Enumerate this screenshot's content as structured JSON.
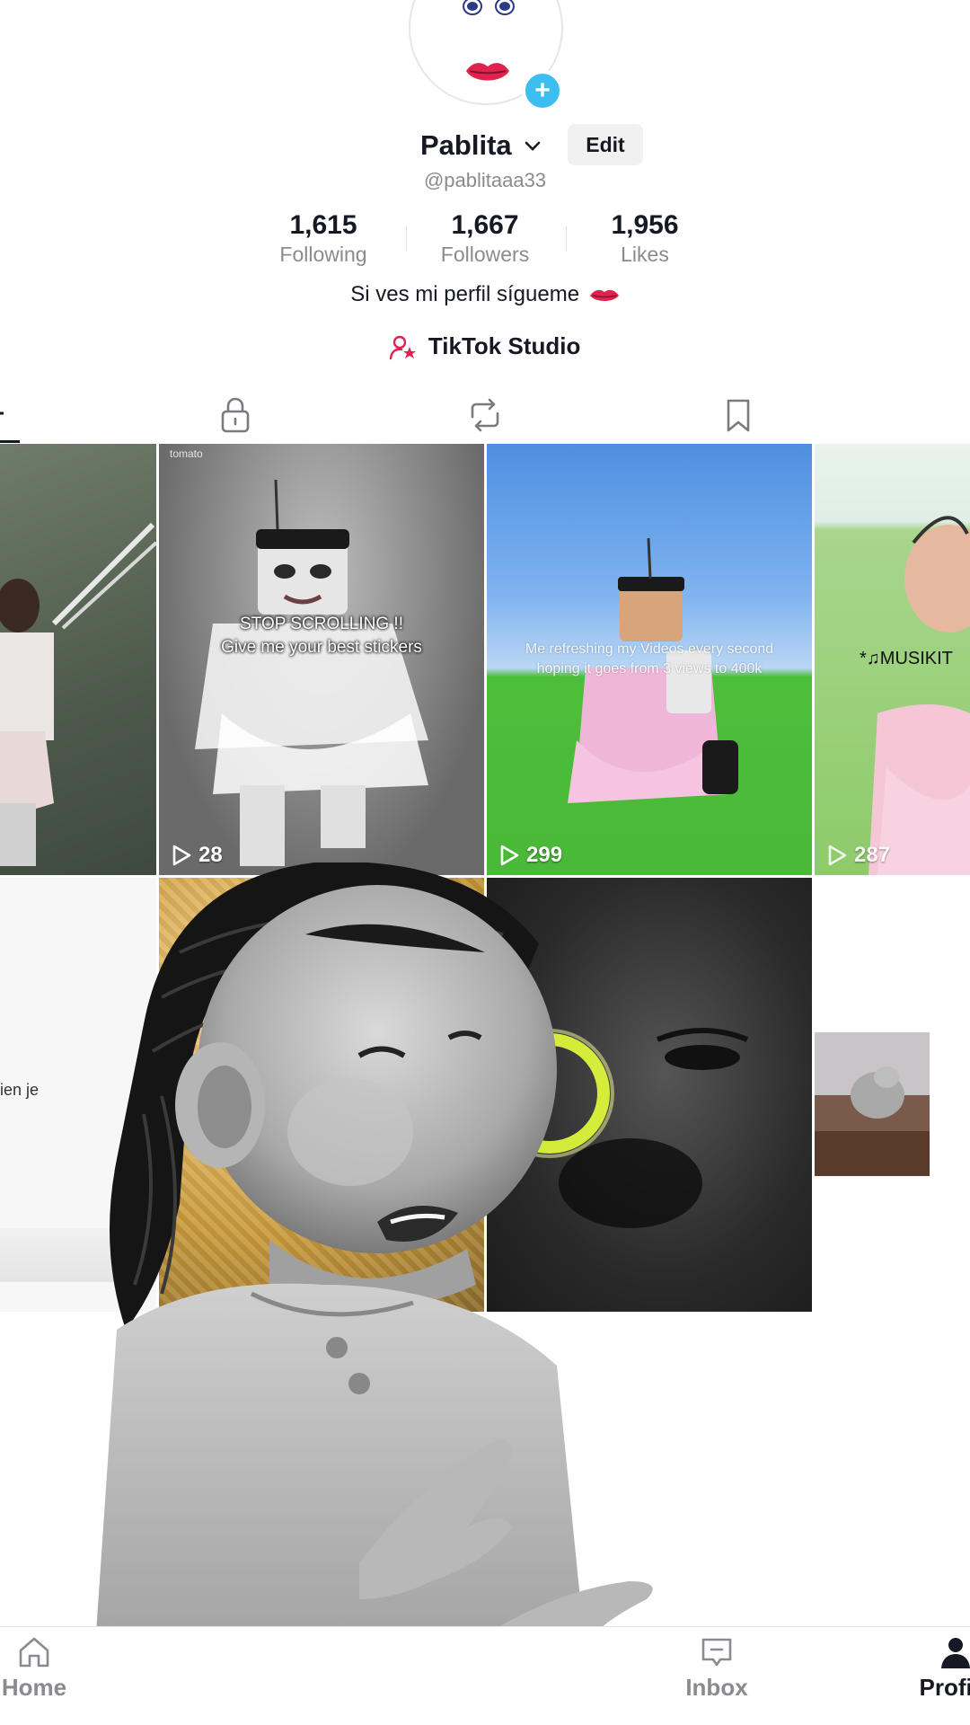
{
  "profile": {
    "name": "Pablita",
    "handle": "@pablitaaa33",
    "edit_label": "Edit",
    "bio": "Si ves mi perfil sígueme",
    "studio_label": "TikTok Studio"
  },
  "stats": [
    {
      "value": "1,615",
      "label": "Following"
    },
    {
      "value": "1,667",
      "label": "Followers"
    },
    {
      "value": "1,956",
      "label": "Likes"
    }
  ],
  "tabs": [
    {
      "icon": "grid-icon"
    },
    {
      "icon": "lock-icon"
    },
    {
      "icon": "repost-icon"
    },
    {
      "icon": "bookmark-icon"
    }
  ],
  "videos": [
    {
      "views": ""
    },
    {
      "watermark": "tomato",
      "caption_line1": "STOP SCROLLING !!",
      "caption_line2": "Give me your best stickers",
      "views": "28"
    },
    {
      "caption_line1": "Me refreshing my Videos every second",
      "caption_line2": "hoping it goes from 3 views to 400k",
      "views": "299"
    },
    {
      "caption": "*♫MUSIKIT",
      "views": "287"
    }
  ],
  "row2": {
    "partial_text": "ien je"
  },
  "nav": {
    "home": "Home",
    "inbox": "Inbox",
    "profile": "Profile"
  },
  "colors": {
    "accent_plus": "#3cbef0",
    "lips": "#e0224e",
    "text_primary": "#161823",
    "text_secondary": "#8a8b91"
  }
}
